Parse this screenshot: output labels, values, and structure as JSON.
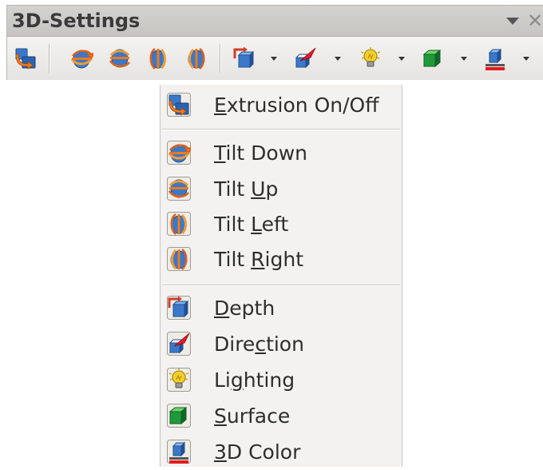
{
  "toolbar": {
    "title": "3D-Settings",
    "buttons": {
      "extrusion": "extrusion-icon",
      "tilt_down": "tilt-down-icon",
      "tilt_up": "tilt-up-icon",
      "tilt_left": "tilt-left-icon",
      "tilt_right": "tilt-right-icon",
      "depth": "depth-icon",
      "direction": "direction-icon",
      "lighting": "lighting-icon",
      "surface": "surface-icon",
      "color": "3d-color-icon"
    }
  },
  "menu": {
    "items": [
      {
        "mn": "E",
        "rest": "xtrusion On/Off",
        "icon": "extrusion-icon"
      },
      {
        "mn": "T",
        "rest": "ilt Down",
        "icon": "tilt-down-icon"
      },
      {
        "pre": "Tilt ",
        "mn": "U",
        "rest": "p",
        "icon": "tilt-up-icon"
      },
      {
        "pre": "Tilt ",
        "mn": "L",
        "rest": "eft",
        "icon": "tilt-left-icon"
      },
      {
        "pre": "Tilt ",
        "mn": "R",
        "rest": "ight",
        "icon": "tilt-right-icon"
      },
      {
        "mn": "D",
        "rest": "epth",
        "icon": "depth-icon"
      },
      {
        "pre": "Dire",
        "mn": "c",
        "rest": "tion",
        "icon": "direction-icon"
      },
      {
        "pre": "Li",
        "mn": "g",
        "rest": "hting",
        "icon": "lighting-icon"
      },
      {
        "mn": "S",
        "rest": "urface",
        "icon": "surface-icon"
      },
      {
        "mn": "3",
        "rest": "D Color",
        "icon": "3d-color-icon"
      }
    ]
  },
  "colors": {
    "extrusion_orange": "#f07a1a",
    "tilt_blue": "#3b78c8",
    "depth_red": "#d23b2a",
    "surface_green": "#1f9a3a",
    "lighting_yellow": "#f2d02b",
    "color_underline": "#e21b1b"
  }
}
